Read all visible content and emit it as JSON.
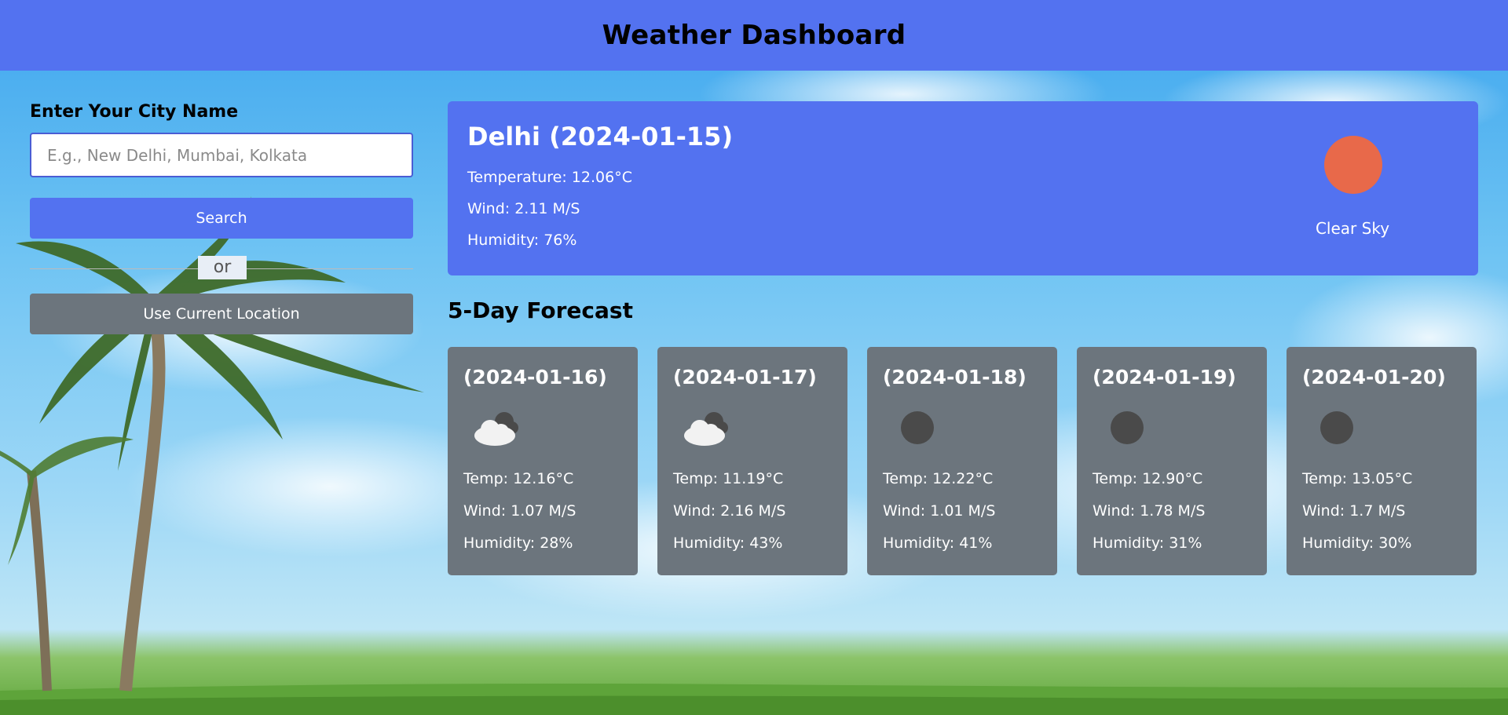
{
  "header": {
    "title": "Weather Dashboard"
  },
  "search": {
    "label": "Enter Your City Name",
    "placeholder": "E.g., New Delhi, Mumbai, Kolkata",
    "value": "",
    "search_button": "Search",
    "separator": "or",
    "location_button": "Use Current Location"
  },
  "current": {
    "title": "Delhi (2024-01-15)",
    "temperature": "Temperature: 12.06°C",
    "wind": "Wind: 2.11 M/S",
    "humidity": "Humidity: 76%",
    "icon": "sun-icon",
    "description": "Clear Sky"
  },
  "forecast": {
    "title": "5-Day Forecast",
    "days": [
      {
        "date": "(2024-01-16)",
        "icon": "cloud-icon",
        "temp": "Temp: 12.16°C",
        "wind": "Wind: 1.07 M/S",
        "humidity": "Humidity: 28%"
      },
      {
        "date": "(2024-01-17)",
        "icon": "cloud-icon",
        "temp": "Temp: 11.19°C",
        "wind": "Wind: 2.16 M/S",
        "humidity": "Humidity: 43%"
      },
      {
        "date": "(2024-01-18)",
        "icon": "clear-icon",
        "temp": "Temp: 12.22°C",
        "wind": "Wind: 1.01 M/S",
        "humidity": "Humidity: 41%"
      },
      {
        "date": "(2024-01-19)",
        "icon": "clear-icon",
        "temp": "Temp: 12.90°C",
        "wind": "Wind: 1.78 M/S",
        "humidity": "Humidity: 31%"
      },
      {
        "date": "(2024-01-20)",
        "icon": "clear-icon",
        "temp": "Temp: 13.05°C",
        "wind": "Wind: 1.7 M/S",
        "humidity": "Humidity: 30%"
      }
    ]
  },
  "colors": {
    "primary": "#5372f0",
    "card": "#6c757d",
    "sun": "#e8694a"
  }
}
